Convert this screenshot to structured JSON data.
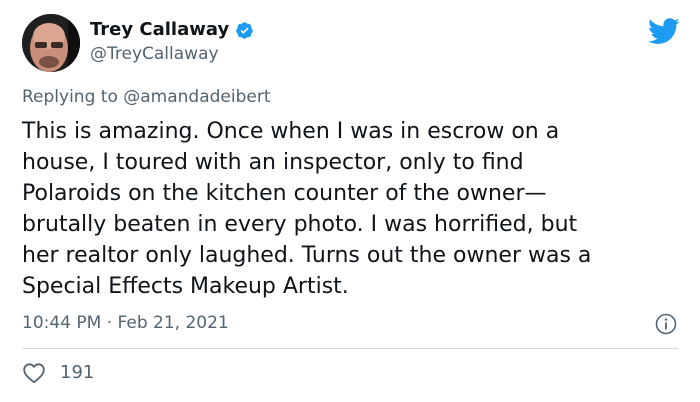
{
  "author": {
    "display_name": "Trey Callaway",
    "handle": "@TreyCallaway",
    "verified": true
  },
  "reply": {
    "prefix": "Replying to",
    "to_handle": "@amandadeibert"
  },
  "tweet": {
    "lines": [
      "This is amazing. Once when I was in escrow on a",
      "house, I toured with an inspector, only to find",
      "Polaroids on the kitchen counter of the owner—",
      "brutally beaten in every photo. I was horrified, but",
      "her realtor only laughed. Turns out the owner was a",
      "Special Effects Makeup Artist."
    ]
  },
  "meta": {
    "time": "10:44 PM",
    "separator": "·",
    "date": "Feb 21, 2021"
  },
  "stats": {
    "likes": "191"
  },
  "icons": {
    "brand": "twitter-bird-icon",
    "verified": "verified-badge-icon",
    "info": "info-icon",
    "like": "heart-icon"
  },
  "colors": {
    "twitter_blue": "#1d9bf0",
    "secondary_text": "#536471",
    "primary_text": "#0f1419",
    "divider": "#cfd9de"
  }
}
